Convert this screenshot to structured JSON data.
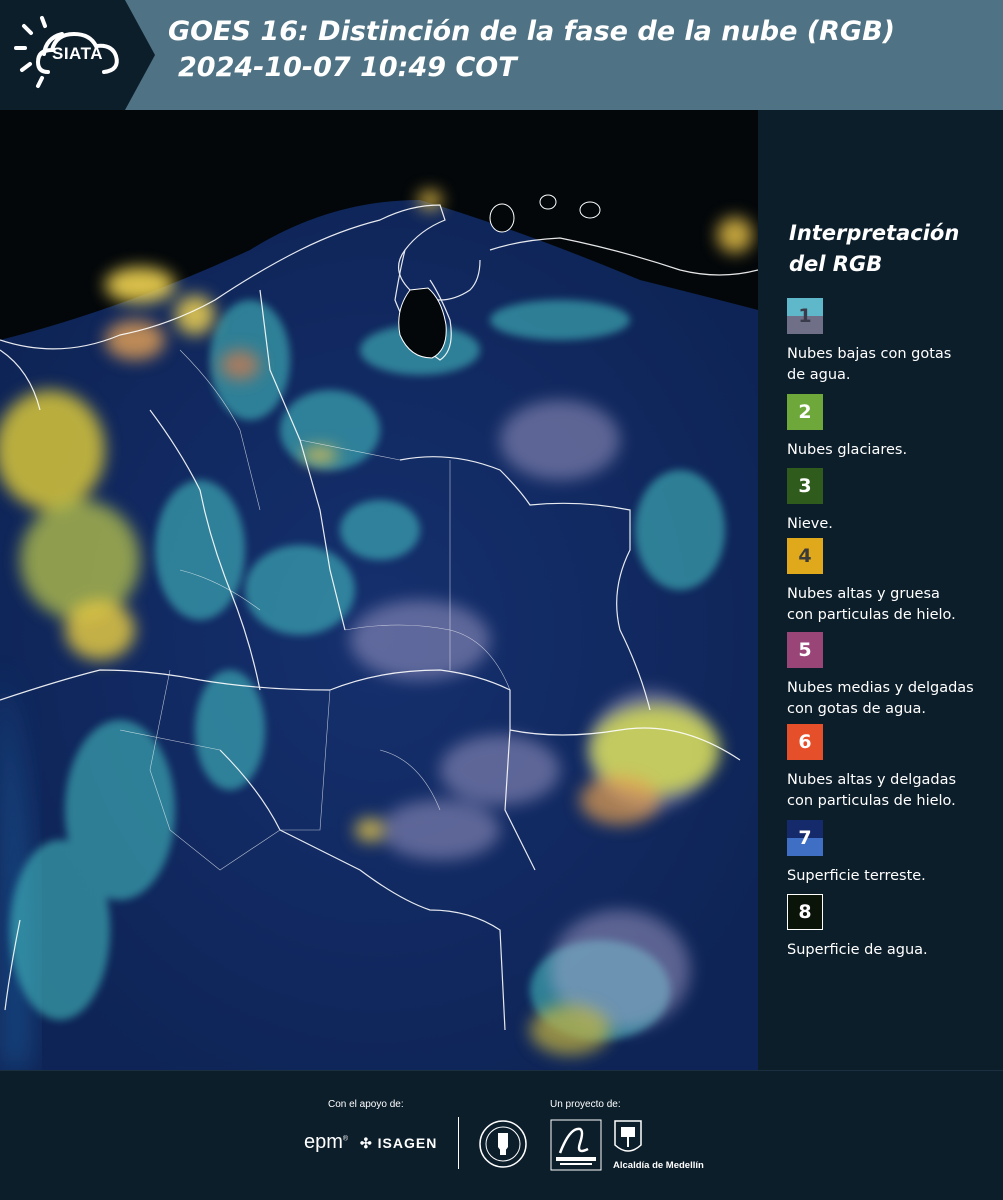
{
  "header": {
    "logo_text": "SIATA",
    "title_line1": "GOES 16: Distinción de la fase de la nube (RGB)",
    "title_line2": "2024-10-07 10:49 COT"
  },
  "legend": {
    "title_line1": "Interpretación",
    "title_line2": "del RGB",
    "items": [
      {
        "number": "1",
        "label_line1": "Nubes bajas con gotas",
        "label_line2": "de agua.",
        "color_top": "#5fb8c9",
        "color_bottom": "#6f6f87"
      },
      {
        "number": "2",
        "label_line1": "Nubes glaciares.",
        "label_line2": "",
        "color": "#6fa83a"
      },
      {
        "number": "3",
        "label_line1": "Nieve.",
        "label_line2": "",
        "color": "#2f5b1d"
      },
      {
        "number": "4",
        "label_line1": "Nubes altas y gruesa",
        "label_line2": "con particulas de hielo.",
        "color": "#e0a91c"
      },
      {
        "number": "5",
        "label_line1": "Nubes medias y delgadas",
        "label_line2": "con gotas de agua.",
        "color": "#9a4578"
      },
      {
        "number": "6",
        "label_line1": "Nubes altas y delgadas",
        "label_line2": "con particulas de hielo.",
        "color": "#e5502a"
      },
      {
        "number": "7",
        "label_line1": "Superficie terreste.",
        "label_line2": "",
        "color_top": "#152a6a",
        "color_bottom": "#3f6fc4"
      },
      {
        "number": "8",
        "label_line1": "Superficie de agua.",
        "label_line2": "",
        "color": "#0b1408"
      }
    ]
  },
  "footer": {
    "support_label": "Con el apoyo de:",
    "project_label": "Un proyecto de:",
    "sponsor_1": "epm",
    "sponsor_2": "ISAGEN",
    "partner_1": "Área Metropolitana Valle de Aburrá",
    "partner_2": "Alcaldía de Medellín"
  },
  "colors": {
    "header_bg": "#4f7384",
    "panel_bg": "#0d1e2b",
    "map_bg": "#0a1736"
  }
}
